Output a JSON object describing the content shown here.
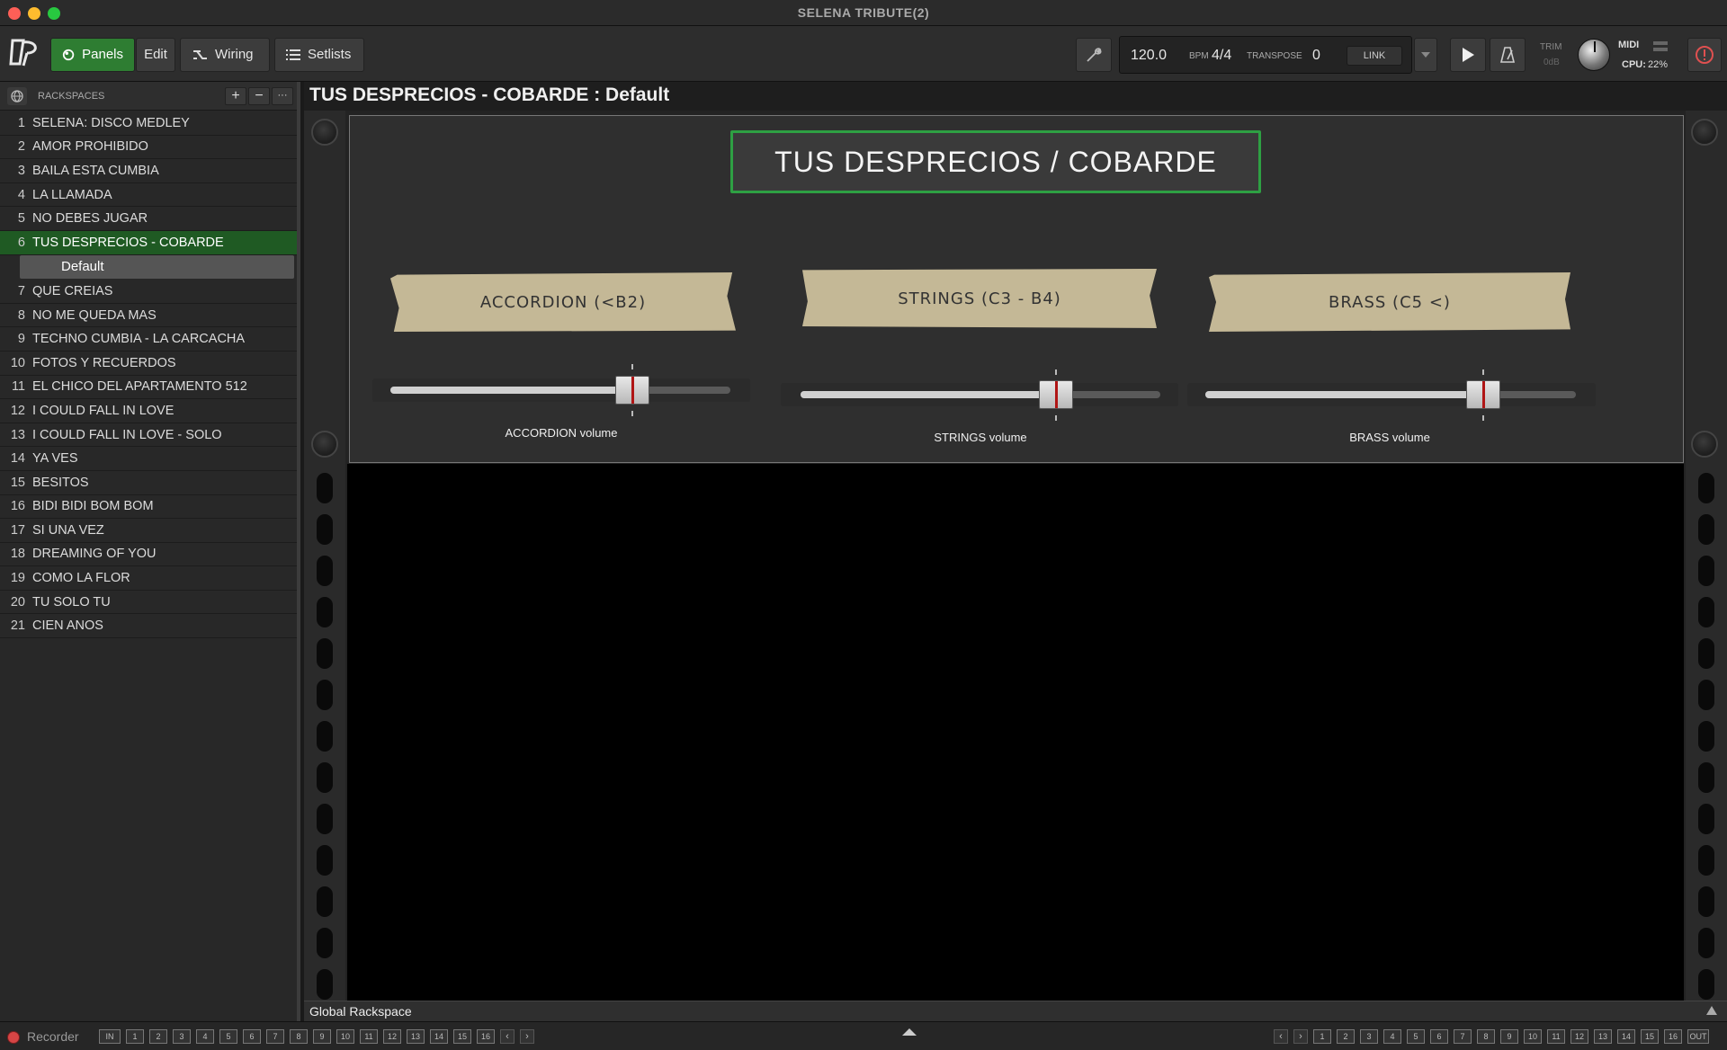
{
  "window": {
    "title": "SELENA TRIBUTE(2)"
  },
  "toolbar": {
    "panels_label": "Panels",
    "edit_label": "Edit",
    "wiring_label": "Wiring",
    "setlists_label": "Setlists",
    "bpm_value": "120.0",
    "bpm_label": "BPM",
    "time_signature": "4/4",
    "transpose_label": "TRANSPOSE",
    "transpose_value": "0",
    "link_label": "LINK",
    "trim_label": "TRIM",
    "trim_value": "0dB",
    "midi_label": "MIDI",
    "cpu_label": "CPU:",
    "cpu_value": "22%"
  },
  "sidebar": {
    "header_label": "RACKSPACES",
    "add_label": "+",
    "remove_label": "−",
    "more_label": "···",
    "items": [
      {
        "num": "1",
        "name": "SELENA: DISCO MEDLEY"
      },
      {
        "num": "2",
        "name": "AMOR PROHIBIDO"
      },
      {
        "num": "3",
        "name": "BAILA ESTA CUMBIA"
      },
      {
        "num": "4",
        "name": "LA LLAMADA"
      },
      {
        "num": "5",
        "name": "NO DEBES JUGAR"
      },
      {
        "num": "6",
        "name": "TUS DESPRECIOS - COBARDE",
        "active": true,
        "variation": "Default"
      },
      {
        "num": "7",
        "name": "QUE CREIAS"
      },
      {
        "num": "8",
        "name": "NO ME QUEDA MAS"
      },
      {
        "num": "9",
        "name": "TECHNO CUMBIA - LA CARCACHA"
      },
      {
        "num": "10",
        "name": "FOTOS Y RECUERDOS"
      },
      {
        "num": "11",
        "name": "EL CHICO DEL APARTAMENTO 512"
      },
      {
        "num": "12",
        "name": "I COULD FALL IN LOVE"
      },
      {
        "num": "13",
        "name": "I COULD FALL IN LOVE - SOLO"
      },
      {
        "num": "14",
        "name": "YA VES"
      },
      {
        "num": "15",
        "name": "BESITOS"
      },
      {
        "num": "16",
        "name": "BIDI BIDI BOM BOM"
      },
      {
        "num": "17",
        "name": "SI UNA VEZ"
      },
      {
        "num": "18",
        "name": "DREAMING OF YOU"
      },
      {
        "num": "19",
        "name": "COMO LA FLOR"
      },
      {
        "num": "20",
        "name": "TU SOLO TU"
      },
      {
        "num": "21",
        "name": "CIEN ANOS"
      }
    ]
  },
  "main": {
    "title": "TUS DESPRECIOS - COBARDE : Default",
    "panel": {
      "song_title": "TUS DESPRECIOS / COBARDE",
      "tape_accordion": "ACCORDION (<B2)",
      "tape_strings": "STRINGS (C3 - B4)",
      "tape_brass": "BRASS (C5 <)",
      "sliders": [
        {
          "label": "ACCORDION volume",
          "value": 0.7
        },
        {
          "label": "STRINGS volume",
          "value": 0.7
        },
        {
          "label": "BRASS volume",
          "value": 0.7
        }
      ]
    }
  },
  "global_rackspace": {
    "label": "Global Rackspace"
  },
  "status_bar": {
    "recorder_label": "Recorder",
    "in_label": "IN",
    "out_label": "OUT",
    "channels": [
      "1",
      "2",
      "3",
      "4",
      "5",
      "6",
      "7",
      "8",
      "9",
      "10",
      "11",
      "12",
      "13",
      "14",
      "15",
      "16"
    ]
  },
  "colors": {
    "accent_green": "#2e7d32",
    "highlight_green": "#2ea043",
    "tape": "#c4b896",
    "fader_marker": "#b01515"
  }
}
